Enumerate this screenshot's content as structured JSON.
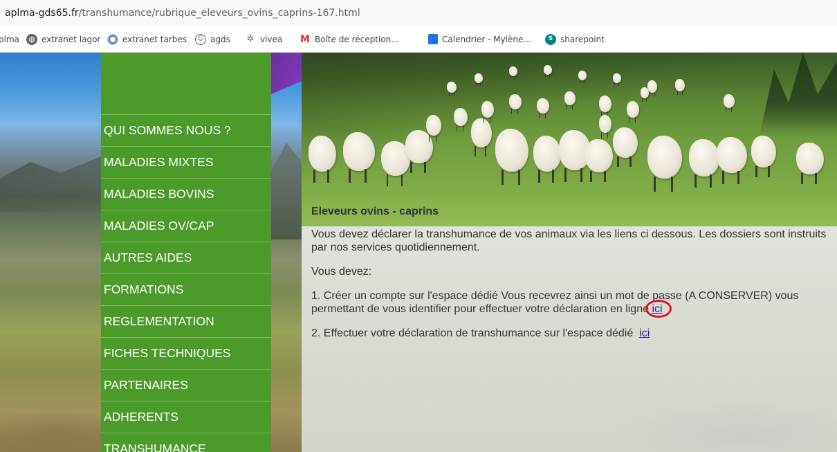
{
  "browser": {
    "url_host": "aplma-gds65.fr",
    "url_path": "/transhumance/rubrique_eleveurs_ovins_caprins-167.html",
    "bookmarks": [
      {
        "label": "plma",
        "icon": "partial-bookmark"
      },
      {
        "label": "extranet lagor",
        "icon": "globe-icon"
      },
      {
        "label": "extranet tarbes",
        "icon": "site-icon"
      },
      {
        "label": "agds",
        "icon": "smiley-icon"
      },
      {
        "label": "vivea",
        "icon": "vivea-icon"
      },
      {
        "label": "Boîte de réception...",
        "icon": "gmail-icon"
      },
      {
        "label": "Calendrier - Mylène...",
        "icon": "calendar-icon"
      },
      {
        "label": "sharepoint",
        "icon": "sharepoint-icon"
      }
    ]
  },
  "nav": {
    "items": [
      {
        "label": "QUI SOMMES NOUS ?"
      },
      {
        "label": "MALADIES MIXTES"
      },
      {
        "label": "MALADIES BOVINS"
      },
      {
        "label": "MALADIES OV/CAP"
      },
      {
        "label": "AUTRES AIDES"
      },
      {
        "label": "FORMATIONS"
      },
      {
        "label": "REGLEMENTATION"
      },
      {
        "label": "FICHES TECHNIQUES"
      },
      {
        "label": "PARTENAIRES"
      },
      {
        "label": "ADHERENTS"
      },
      {
        "label": "TRANSHUMANCE"
      }
    ]
  },
  "content": {
    "title": "Eleveurs ovins  - caprins",
    "intro": "Vous devez déclarer la transhumance de vos animaux via les liens ci dessous. Les dossiers sont instruits par nos services quotidiennement.",
    "vous_devez": "Vous devez:",
    "step1_text": "1. Créer un compte sur l'espace dédié Vous recevrez ainsi un mot de passe (A CONSERVER) vous permettant de vous identifier pour effectuer votre déclaration en ligne ",
    "step1_link": "ici",
    "step2_text": "2. Effectuer votre déclaration de transhumance sur l'espace dédié  ",
    "step2_link": "ici"
  },
  "colors": {
    "nav_green": "#4c9a2a",
    "link": "#3b1e8a",
    "highlight_circle": "#e0141e",
    "purple_accent": "#7a35b0"
  }
}
